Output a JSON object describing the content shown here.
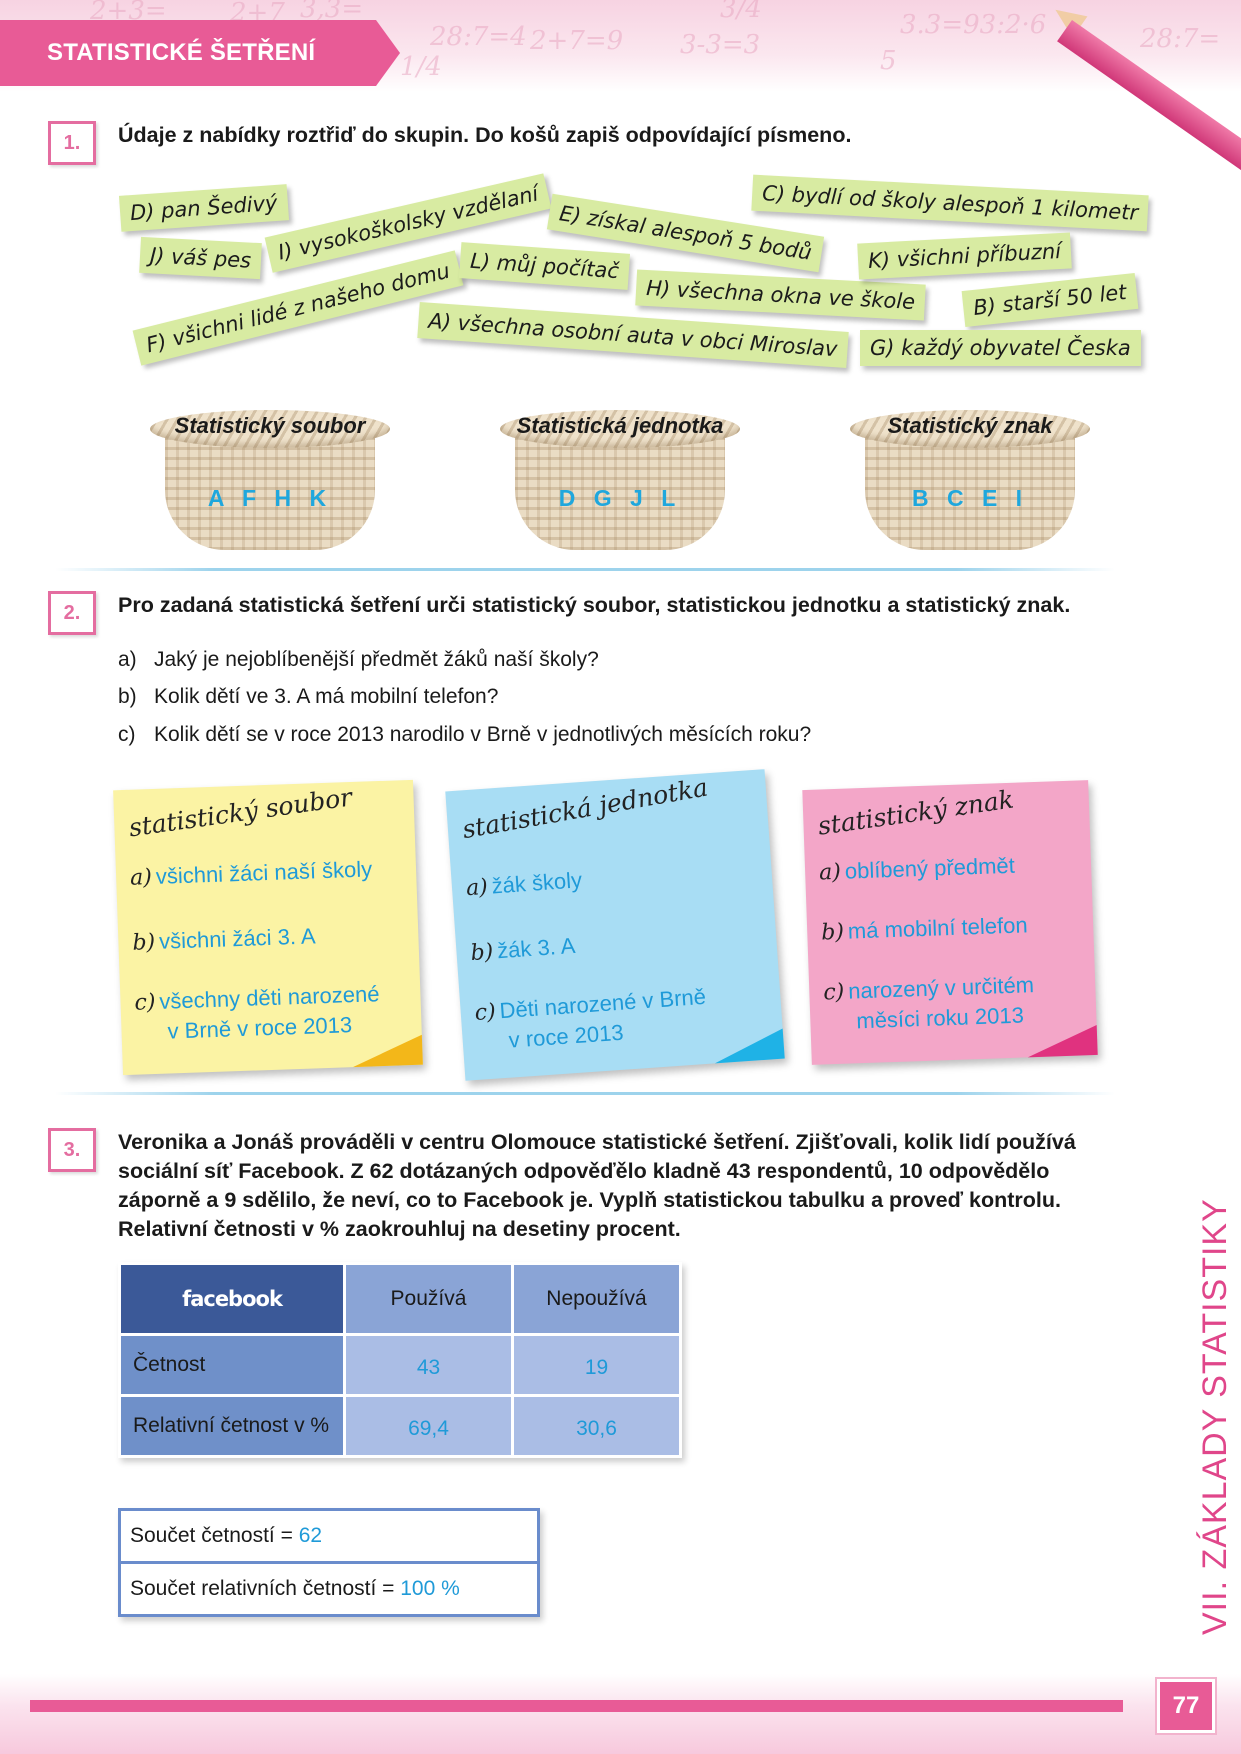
{
  "header": {
    "title": "STATISTICKÉ ŠETŘENÍ",
    "doodles": [
      "2+3=",
      "2+7",
      "3,3=",
      "1/4",
      "28:7=4",
      "2+7=9",
      "3-3=3",
      "3/4",
      "3.3=93:2·6",
      "5",
      "28:7="
    ]
  },
  "task1": {
    "number": "1.",
    "instruction": "Údaje z nabídky roztřiď do skupin. Do košů zapiš odpovídající písmeno.",
    "tags": [
      "D) pan Šedivý",
      "J) váš pes",
      "I) vysokoškolsky vzdělaní",
      "F) všichni lidé z našeho domu",
      "E) získal alespoň 5 bodů",
      "L) můj počítač",
      "A) všechna osobní auta v obci Miroslav",
      "H) všechna okna ve škole",
      "C) bydlí od školy alespoň 1 kilometr",
      "K) všichni příbuzní",
      "B) starší 50 let",
      "G) každý obyvatel Česka"
    ],
    "baskets": [
      {
        "title": "Statistický soubor",
        "answer": "A F H K"
      },
      {
        "title": "Statistická jednotka",
        "answer": "D G J L"
      },
      {
        "title": "Statistický znak",
        "answer": "B C E I"
      }
    ]
  },
  "task2": {
    "number": "2.",
    "instruction": "Pro zadaná statistická šetření urči statistický soubor, statistickou jednotku a statistický znak.",
    "questions": [
      {
        "label": "a)",
        "text": "Jaký je nejoblíbenější předmět žáků naší školy?"
      },
      {
        "label": "b)",
        "text": "Kolik dětí ve 3. A má mobilní telefon?"
      },
      {
        "label": "c)",
        "text": "Kolik dětí se v roce 2013 narodilo v Brně v jednotlivých měsících roku?"
      }
    ],
    "notes": [
      {
        "title": "statistický soubor",
        "items": [
          {
            "label": "a)",
            "lines": [
              "všichni žáci naší školy"
            ]
          },
          {
            "label": "b)",
            "lines": [
              "všichni žáci 3. A"
            ]
          },
          {
            "label": "c)",
            "lines": [
              "všechny děti narozené",
              "v Brně v roce 2013"
            ]
          }
        ],
        "color": "#fbf3a4",
        "curl": "#f3b719"
      },
      {
        "title": "statistická jednotka",
        "items": [
          {
            "label": "a)",
            "lines": [
              "žák školy"
            ]
          },
          {
            "label": "b)",
            "lines": [
              "žák 3. A"
            ]
          },
          {
            "label": "c)",
            "lines": [
              "Děti narozené v Brně",
              "v roce 2013"
            ]
          }
        ],
        "color": "#a8ddf4",
        "curl": "#1fb2e6"
      },
      {
        "title": "statistický znak",
        "items": [
          {
            "label": "a)",
            "lines": [
              "oblíbený předmět"
            ]
          },
          {
            "label": "b)",
            "lines": [
              "má mobilní telefon"
            ]
          },
          {
            "label": "c)",
            "lines": [
              "narozený v určitém",
              "měsíci roku 2013"
            ]
          }
        ],
        "color": "#f3a6c8",
        "curl": "#e0327f"
      }
    ]
  },
  "task3": {
    "number": "3.",
    "instruction_lines": [
      "Veronika a Jonáš prováděli v centru Olomouce statistické šetření. Zjišťovali, kolik lidí používá",
      "sociální síť Facebook. Z 62 dotázaných odpověďělo kladně 43 respondentů, 10 odpovědělo",
      "záporně a 9 sdělilo, že neví, co to Facebook je.  Vyplň statistickou tabulku a proveď kontrolu.",
      "Relativní četnosti v % zaokrouhluj na desetiny procent."
    ],
    "table": {
      "logo": "facebook",
      "columns": [
        "Používá",
        "Nepoužívá"
      ],
      "rows": [
        {
          "label": "Četnost",
          "values": [
            "43",
            "19"
          ]
        },
        {
          "label": "Relativní četnost v %",
          "values": [
            "69,4",
            "30,6"
          ]
        }
      ]
    },
    "sums": [
      {
        "label": "Součet četností = ",
        "value": "62"
      },
      {
        "label": "Součet relativních četností = ",
        "value": "100 %"
      }
    ]
  },
  "side_title": "VII. ZÁKLADY STATISTIKY",
  "page_number": "77",
  "colors": {
    "accent": "#e85b96",
    "answer": "#1f9ad8",
    "tag": "#d8eba2",
    "table_header": "#3b5998"
  }
}
